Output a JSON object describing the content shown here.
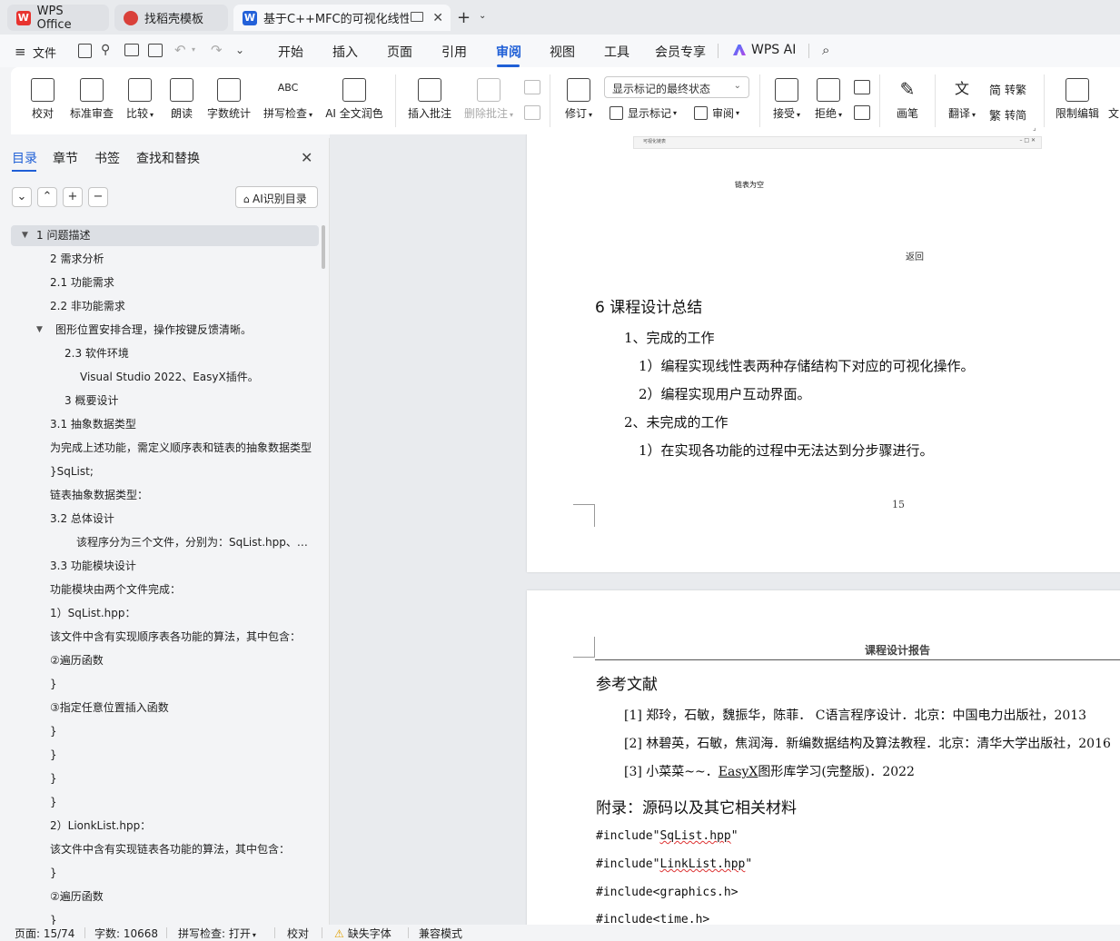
{
  "tabs": [
    {
      "label": "WPS Office",
      "logo": "W",
      "logo_color": "#e8332f"
    },
    {
      "label": "找稻壳模板",
      "logo": "",
      "logo_color": "#d9403a"
    },
    {
      "label": "基于C++MFC的可视化线性表",
      "logo": "W",
      "logo_color": "#2361d9"
    }
  ],
  "menu": {
    "file": "文件",
    "items": [
      "开始",
      "插入",
      "页面",
      "引用",
      "审阅",
      "视图",
      "工具",
      "会员专享"
    ],
    "active": "审阅",
    "wps_ai": "WPS AI"
  },
  "ribbon": {
    "proofread": "校对",
    "std_review": "标准审查",
    "compare": "比较",
    "read_aloud": "朗读",
    "word_count": "字数统计",
    "spell_check": "拼写检查",
    "ai_polish": "AI 全文润色",
    "insert_comment": "插入批注",
    "delete_comment": "删除批注",
    "track_changes": "修订",
    "markup_dropdown": "显示标记的最终状态",
    "show_markup": "显示标记",
    "review_pane": "审阅",
    "accept": "接受",
    "reject": "拒绝",
    "pen": "画笔",
    "translate": "翻译",
    "to_traditional": "转繁",
    "to_simplified": "转简",
    "restrict_edit": "限制编辑",
    "doc_more": "文"
  },
  "sidebar": {
    "tabs": [
      "目录",
      "章节",
      "书签",
      "查找和替换"
    ],
    "ai_toc": "AI识别目录",
    "toc": [
      "1  问题描述",
      "2  需求分析",
      "2.1  功能需求",
      "2.2  非功能需求",
      "图形位置安排合理，操作按键反馈清晰。",
      "2.3  软件环境",
      "Visual Studio 2022、EasyX插件。",
      "3  概要设计",
      "3.1 抽象数据类型",
      "为完成上述功能，需定义顺序表和链表的抽象数据类型",
      "}SqList;",
      "链表抽象数据类型：",
      "3.2  总体设计",
      "该程序分为三个文件，分别为：SqList.hpp、LinkList.hpp",
      "3.3  功能模块设计",
      "功能模块由两个文件完成：",
      "1）SqList.hpp：",
      "该文件中含有实现顺序表各功能的算法，其中包含：",
      "②遍历函数",
      "}",
      "③指定任意位置插入函数",
      "}",
      "}",
      "}",
      "}",
      "2）LionkList.hpp：",
      "该文件中含有实现链表各功能的算法，其中包含：",
      "}",
      "②遍历函数",
      "}"
    ]
  },
  "document": {
    "screenshot_title": "可视化链表",
    "empty_list_text": "链表为空",
    "back_text": "返回",
    "sec6_title": "6  课程设计总结",
    "done_heading": "1、完成的工作",
    "done_1": "1）编程实现线性表两种存储结构下对应的可视化操作。",
    "done_2": "2）编程实现用户互动界面。",
    "undone_heading": "2、未完成的工作",
    "undone_1": "1）在实现各功能的过程中无法达到分步骤进行。",
    "page_number": "15",
    "header_text": "课程设计报告",
    "refs_title": "参考文献",
    "ref1": "[1]  郑玲，石敏，魏振华，陈菲．  C语言程序设计．北京：中国电力出版社，2013",
    "ref2": "[2]  林碧英，石敏，焦润海．新编数据结构及算法教程．北京：清华大学出版社，2016",
    "ref3_pre": "[3]  小菜菜~~．",
    "ref3_link": "EasyX",
    "ref3_post": "图形库学习(完整版)．2022",
    "appendix_title": "附录：源码以及其它相关材料",
    "inc1_pre": "#include\"",
    "inc1_file": "SqList.hpp",
    "inc1_post": "\"",
    "inc2_pre": "#include\"",
    "inc2_file": "LinkList.hpp",
    "inc2_post": "\"",
    "inc3": "#include<graphics.h>",
    "inc4": "#include<time.h>"
  },
  "status": {
    "page": "页面: 15/74",
    "words": "字数: 10668",
    "spell": "拼写检查: 打开",
    "proof": "校对",
    "missing_font": "缺失字体",
    "compat": "兼容模式"
  }
}
